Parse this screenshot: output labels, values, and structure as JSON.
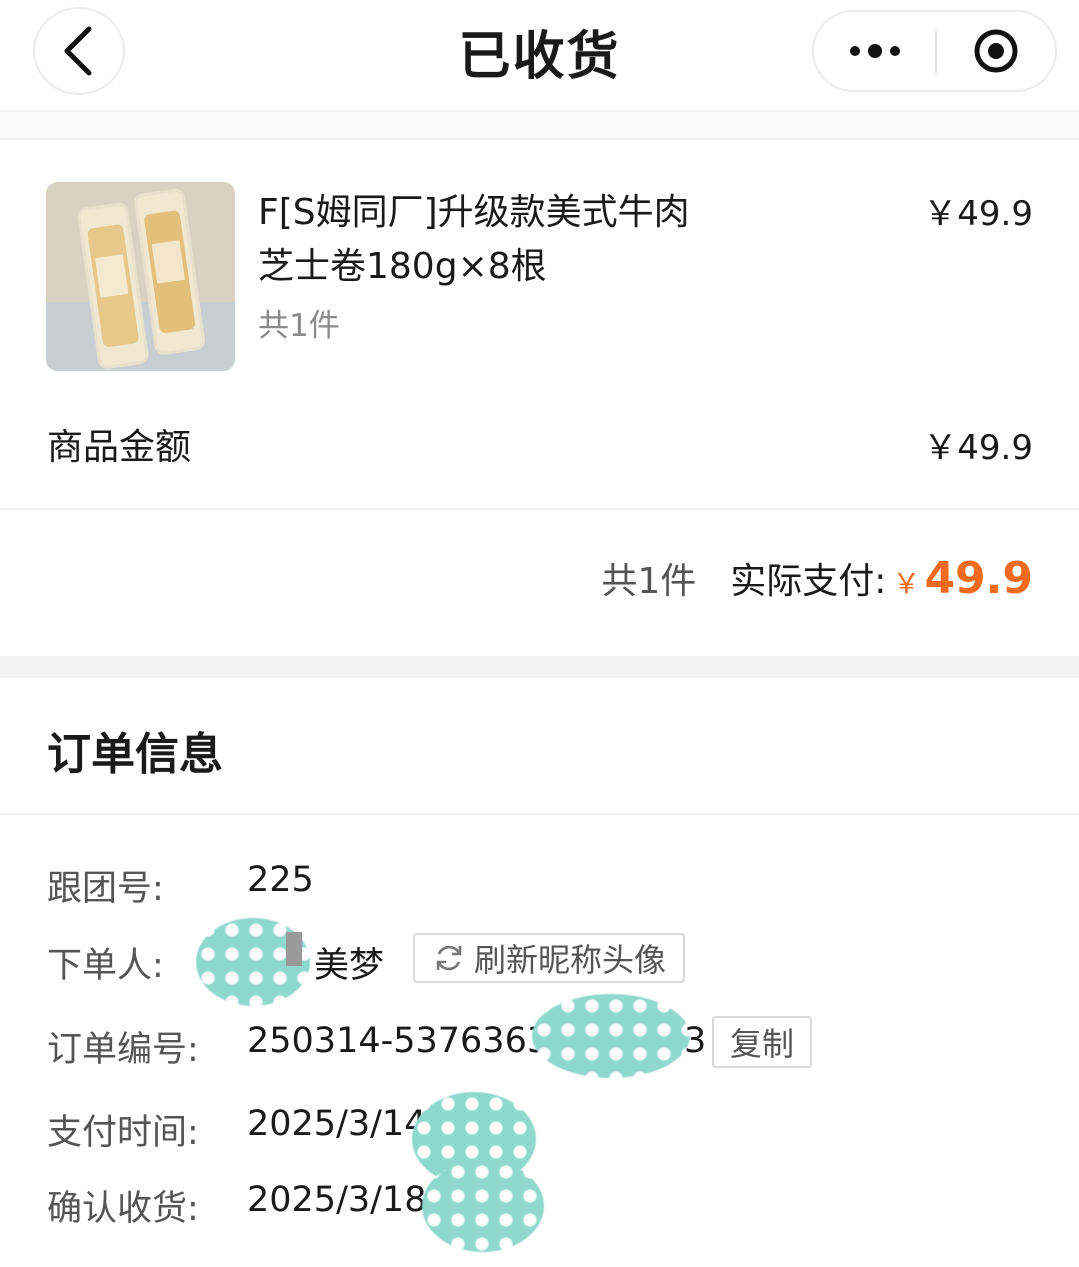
{
  "header": {
    "title": "已收货",
    "back_icon": "chevron-left-icon",
    "more_icon": "more-dots-icon",
    "close_icon": "target-circle-icon"
  },
  "product": {
    "name_line1": "F[S姆同厂]升级款美式牛肉",
    "name_line2": "芝士卷180g×8根",
    "quantity": "共1件",
    "price": "￥49.9"
  },
  "summary": {
    "amount_label": "商品金额",
    "amount_value": "￥49.9",
    "total_count": "共1件",
    "paid_label": "实际支付:",
    "paid_currency": "￥",
    "paid_value": "49.9",
    "accent_color": "#f26b1d"
  },
  "order_info": {
    "section_title": "订单信息",
    "group_no_label": "跟团号:",
    "group_no_value": "225",
    "buyer_label": "下单人:",
    "buyer_name": "美梦",
    "refresh_button": "刷新昵称头像",
    "refresh_icon": "refresh-icon",
    "order_no_label": "订单编号:",
    "order_no_prefix": "250314-5376363",
    "order_no_suffix": "3",
    "copy_button": "复制",
    "pay_time_label": "支付时间:",
    "pay_time_value": "2025/3/14",
    "confirm_label": "确认收货:",
    "confirm_value": "2025/3/18"
  }
}
